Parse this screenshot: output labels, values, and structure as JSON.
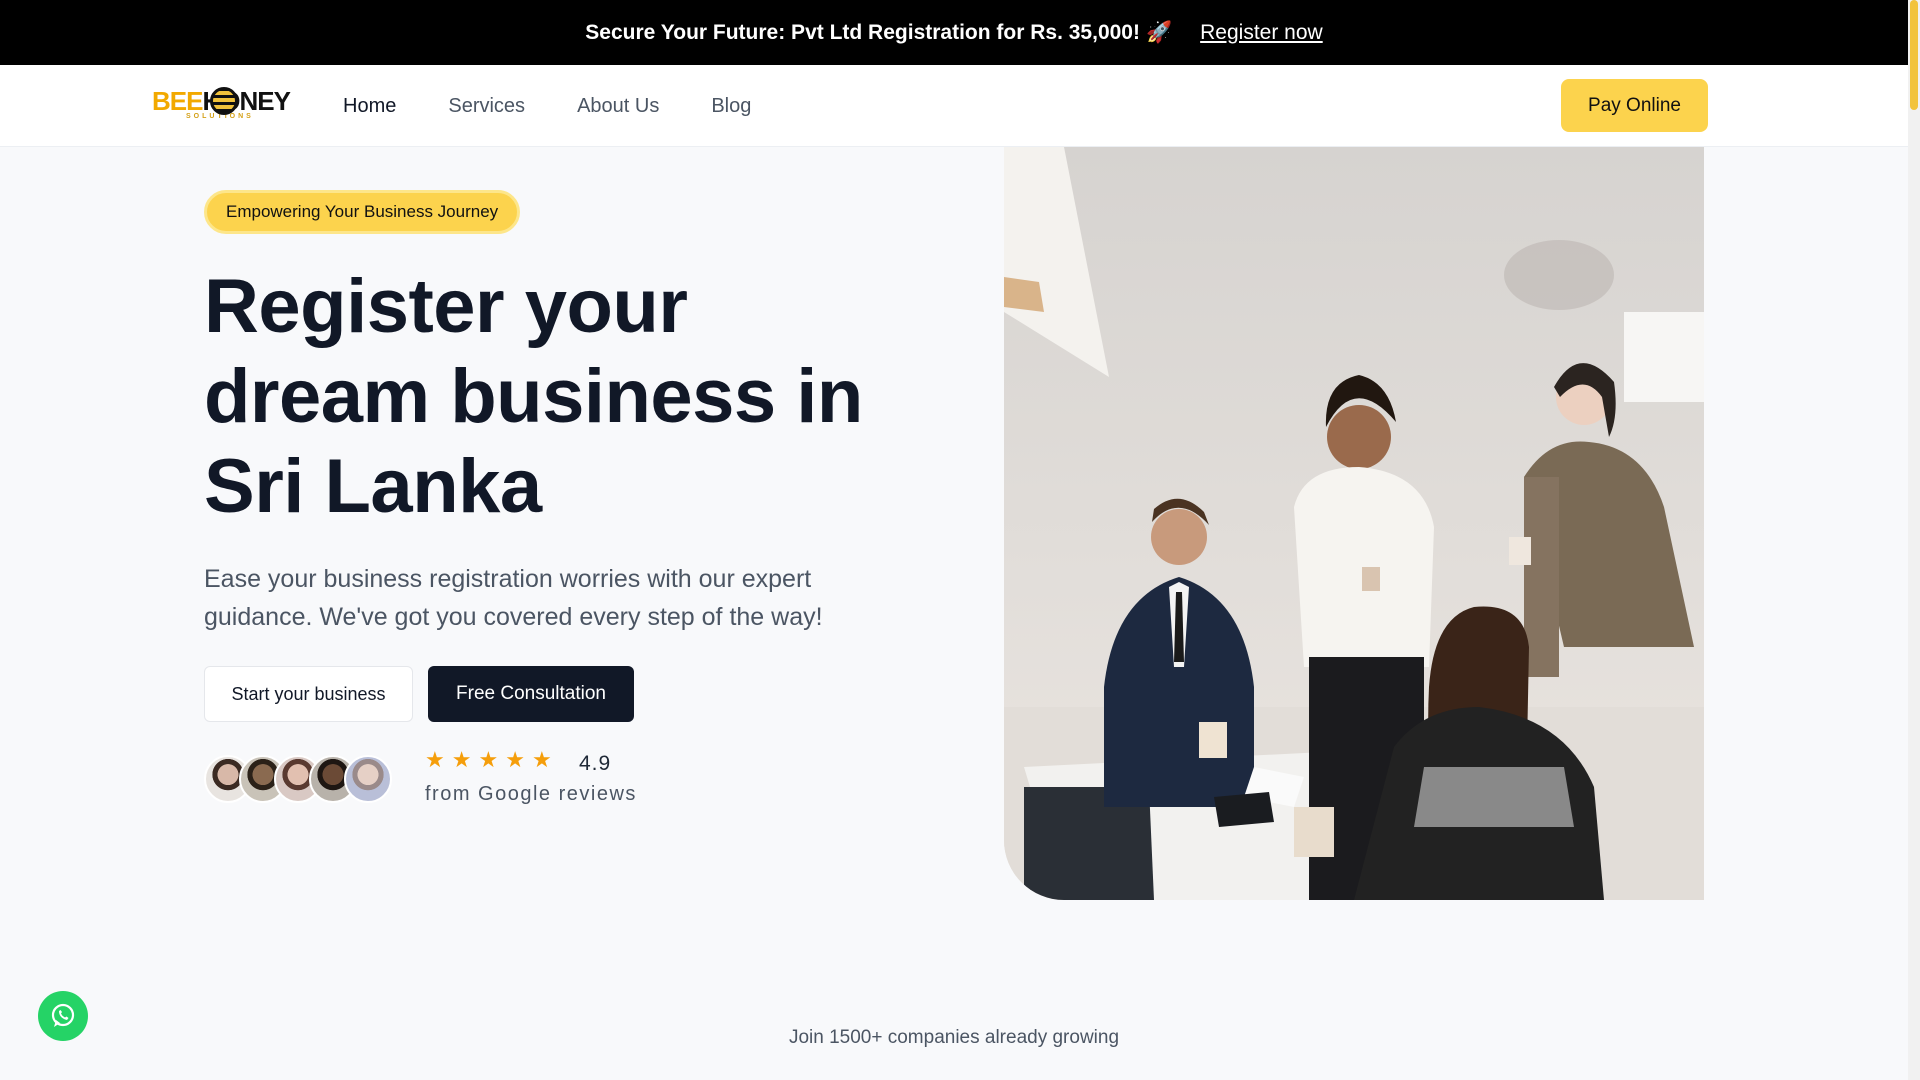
{
  "promo": {
    "text": "Secure Your Future: Pvt Ltd Registration for Rs. 35,000!",
    "emoji": "🚀",
    "link": "Register now"
  },
  "logo": {
    "bee": "BEE",
    "honey": "HONEY",
    "sub": "SOLUTIONS"
  },
  "nav": {
    "items": [
      "Home",
      "Services",
      "About Us",
      "Blog"
    ],
    "active": "Home",
    "cta": "Pay Online"
  },
  "hero": {
    "badge": "Empowering Your Business Journey",
    "headline_lines": [
      "Register your",
      "dream business in",
      "Sri Lanka"
    ],
    "subtext": "Ease your business registration worries with our expert guidance. We've got you covered every step of the way!",
    "btn_start": "Start your business",
    "btn_consult": "Free Consultation",
    "rating_value": "4.9",
    "rating_stars": 5,
    "reviews_label": "from Google reviews"
  },
  "footer": {
    "join": "Join 1500+ companies already growing"
  },
  "colors": {
    "accent": "#fcd34d",
    "dark": "#111827",
    "whatsapp": "#25d366",
    "star": "#f59e0b"
  }
}
